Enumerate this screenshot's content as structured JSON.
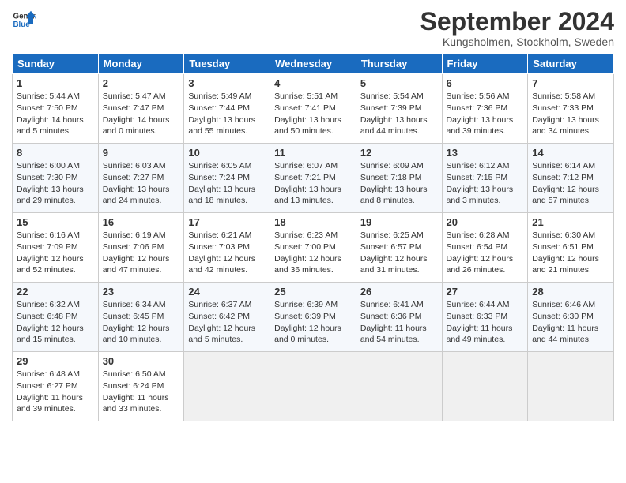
{
  "header": {
    "logo_general": "General",
    "logo_blue": "Blue",
    "title": "September 2024",
    "subtitle": "Kungsholmen, Stockholm, Sweden"
  },
  "days_of_week": [
    "Sunday",
    "Monday",
    "Tuesday",
    "Wednesday",
    "Thursday",
    "Friday",
    "Saturday"
  ],
  "weeks": [
    [
      {
        "day": "1",
        "rise": "5:44 AM",
        "set": "7:50 PM",
        "daylight": "14 hours and 5 minutes."
      },
      {
        "day": "2",
        "rise": "5:47 AM",
        "set": "7:47 PM",
        "daylight": "14 hours and 0 minutes."
      },
      {
        "day": "3",
        "rise": "5:49 AM",
        "set": "7:44 PM",
        "daylight": "13 hours and 55 minutes."
      },
      {
        "day": "4",
        "rise": "5:51 AM",
        "set": "7:41 PM",
        "daylight": "13 hours and 50 minutes."
      },
      {
        "day": "5",
        "rise": "5:54 AM",
        "set": "7:39 PM",
        "daylight": "13 hours and 44 minutes."
      },
      {
        "day": "6",
        "rise": "5:56 AM",
        "set": "7:36 PM",
        "daylight": "13 hours and 39 minutes."
      },
      {
        "day": "7",
        "rise": "5:58 AM",
        "set": "7:33 PM",
        "daylight": "13 hours and 34 minutes."
      }
    ],
    [
      {
        "day": "8",
        "rise": "6:00 AM",
        "set": "7:30 PM",
        "daylight": "13 hours and 29 minutes."
      },
      {
        "day": "9",
        "rise": "6:03 AM",
        "set": "7:27 PM",
        "daylight": "13 hours and 24 minutes."
      },
      {
        "day": "10",
        "rise": "6:05 AM",
        "set": "7:24 PM",
        "daylight": "13 hours and 18 minutes."
      },
      {
        "day": "11",
        "rise": "6:07 AM",
        "set": "7:21 PM",
        "daylight": "13 hours and 13 minutes."
      },
      {
        "day": "12",
        "rise": "6:09 AM",
        "set": "7:18 PM",
        "daylight": "13 hours and 8 minutes."
      },
      {
        "day": "13",
        "rise": "6:12 AM",
        "set": "7:15 PM",
        "daylight": "13 hours and 3 minutes."
      },
      {
        "day": "14",
        "rise": "6:14 AM",
        "set": "7:12 PM",
        "daylight": "12 hours and 57 minutes."
      }
    ],
    [
      {
        "day": "15",
        "rise": "6:16 AM",
        "set": "7:09 PM",
        "daylight": "12 hours and 52 minutes."
      },
      {
        "day": "16",
        "rise": "6:19 AM",
        "set": "7:06 PM",
        "daylight": "12 hours and 47 minutes."
      },
      {
        "day": "17",
        "rise": "6:21 AM",
        "set": "7:03 PM",
        "daylight": "12 hours and 42 minutes."
      },
      {
        "day": "18",
        "rise": "6:23 AM",
        "set": "7:00 PM",
        "daylight": "12 hours and 36 minutes."
      },
      {
        "day": "19",
        "rise": "6:25 AM",
        "set": "6:57 PM",
        "daylight": "12 hours and 31 minutes."
      },
      {
        "day": "20",
        "rise": "6:28 AM",
        "set": "6:54 PM",
        "daylight": "12 hours and 26 minutes."
      },
      {
        "day": "21",
        "rise": "6:30 AM",
        "set": "6:51 PM",
        "daylight": "12 hours and 21 minutes."
      }
    ],
    [
      {
        "day": "22",
        "rise": "6:32 AM",
        "set": "6:48 PM",
        "daylight": "12 hours and 15 minutes."
      },
      {
        "day": "23",
        "rise": "6:34 AM",
        "set": "6:45 PM",
        "daylight": "12 hours and 10 minutes."
      },
      {
        "day": "24",
        "rise": "6:37 AM",
        "set": "6:42 PM",
        "daylight": "12 hours and 5 minutes."
      },
      {
        "day": "25",
        "rise": "6:39 AM",
        "set": "6:39 PM",
        "daylight": "12 hours and 0 minutes."
      },
      {
        "day": "26",
        "rise": "6:41 AM",
        "set": "6:36 PM",
        "daylight": "11 hours and 54 minutes."
      },
      {
        "day": "27",
        "rise": "6:44 AM",
        "set": "6:33 PM",
        "daylight": "11 hours and 49 minutes."
      },
      {
        "day": "28",
        "rise": "6:46 AM",
        "set": "6:30 PM",
        "daylight": "11 hours and 44 minutes."
      }
    ],
    [
      {
        "day": "29",
        "rise": "6:48 AM",
        "set": "6:27 PM",
        "daylight": "11 hours and 39 minutes."
      },
      {
        "day": "30",
        "rise": "6:50 AM",
        "set": "6:24 PM",
        "daylight": "11 hours and 33 minutes."
      },
      null,
      null,
      null,
      null,
      null
    ]
  ]
}
